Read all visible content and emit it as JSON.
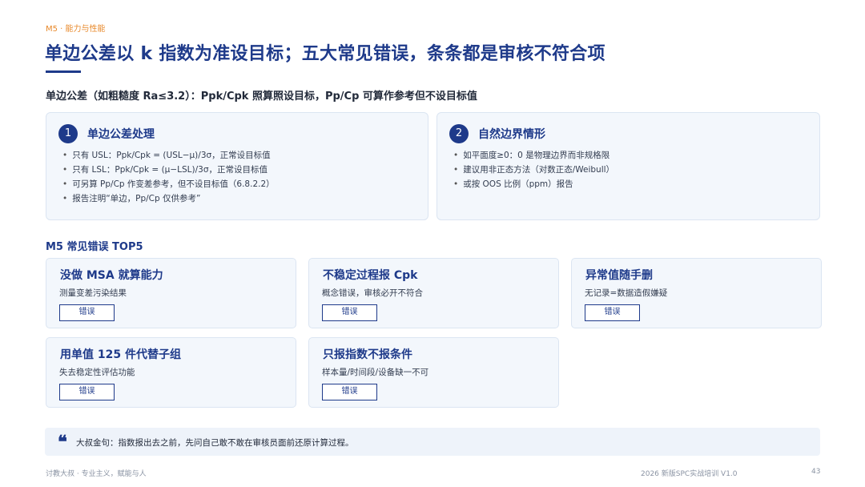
{
  "header": {
    "kicker": "M5 · 能力与性能",
    "title": "单边公差以 k 指数为准设目标；五大常见错误，条条都是审核不符合项",
    "subtitle": "单边公差（如粗糙度 Ra≤3.2）：Ppk/Cpk 照算照设目标，Pp/Cp 可算作参考但不设目标值"
  },
  "boxes": [
    {
      "number": "1",
      "heading": "单边公差处理",
      "bullets": [
        "只有 USL：Ppk/Cpk = (USL−μ)/3σ，正常设目标值",
        "只有 LSL：Ppk/Cpk = (μ−LSL)/3σ，正常设目标值",
        "可另算 Pp/Cp 作变差参考，但不设目标值（6.8.2.2）",
        "报告注明“单边，Pp/Cp 仅供参考”"
      ]
    },
    {
      "number": "2",
      "heading": "自然边界情形",
      "bullets": [
        "如平面度≥0：0 是物理边界而非规格限",
        "建议用非正态方法（对数正态/Weibull）",
        "或按 OOS 比例（ppm）报告"
      ]
    }
  ],
  "errors_section": {
    "heading": "M5 常见错误 TOP5",
    "items": [
      {
        "title": "没做 MSA 就算能力",
        "desc": "测量变差污染结果",
        "tag": "错误"
      },
      {
        "title": "不稳定过程报 Cpk",
        "desc": "概念错误，审核必开不符合",
        "tag": "错误"
      },
      {
        "title": "异常值随手删",
        "desc": "无记录=数据造假嫌疑",
        "tag": "错误"
      },
      {
        "title": "用单值 125 件代替子组",
        "desc": "失去稳定性评估功能",
        "tag": "错误"
      },
      {
        "title": "只报指数不报条件",
        "desc": "样本量/时间段/设备缺一不可",
        "tag": "错误"
      }
    ]
  },
  "quote": {
    "mark": "❝",
    "text": "大叔金句：指数报出去之前，先问自己敢不敢在审核员面前还原计算过程。"
  },
  "footer": {
    "left": "讨教大叔 · 专业主义，赋能与人",
    "center": "2026 新版SPC实战培训 V1.0",
    "page": "43"
  }
}
